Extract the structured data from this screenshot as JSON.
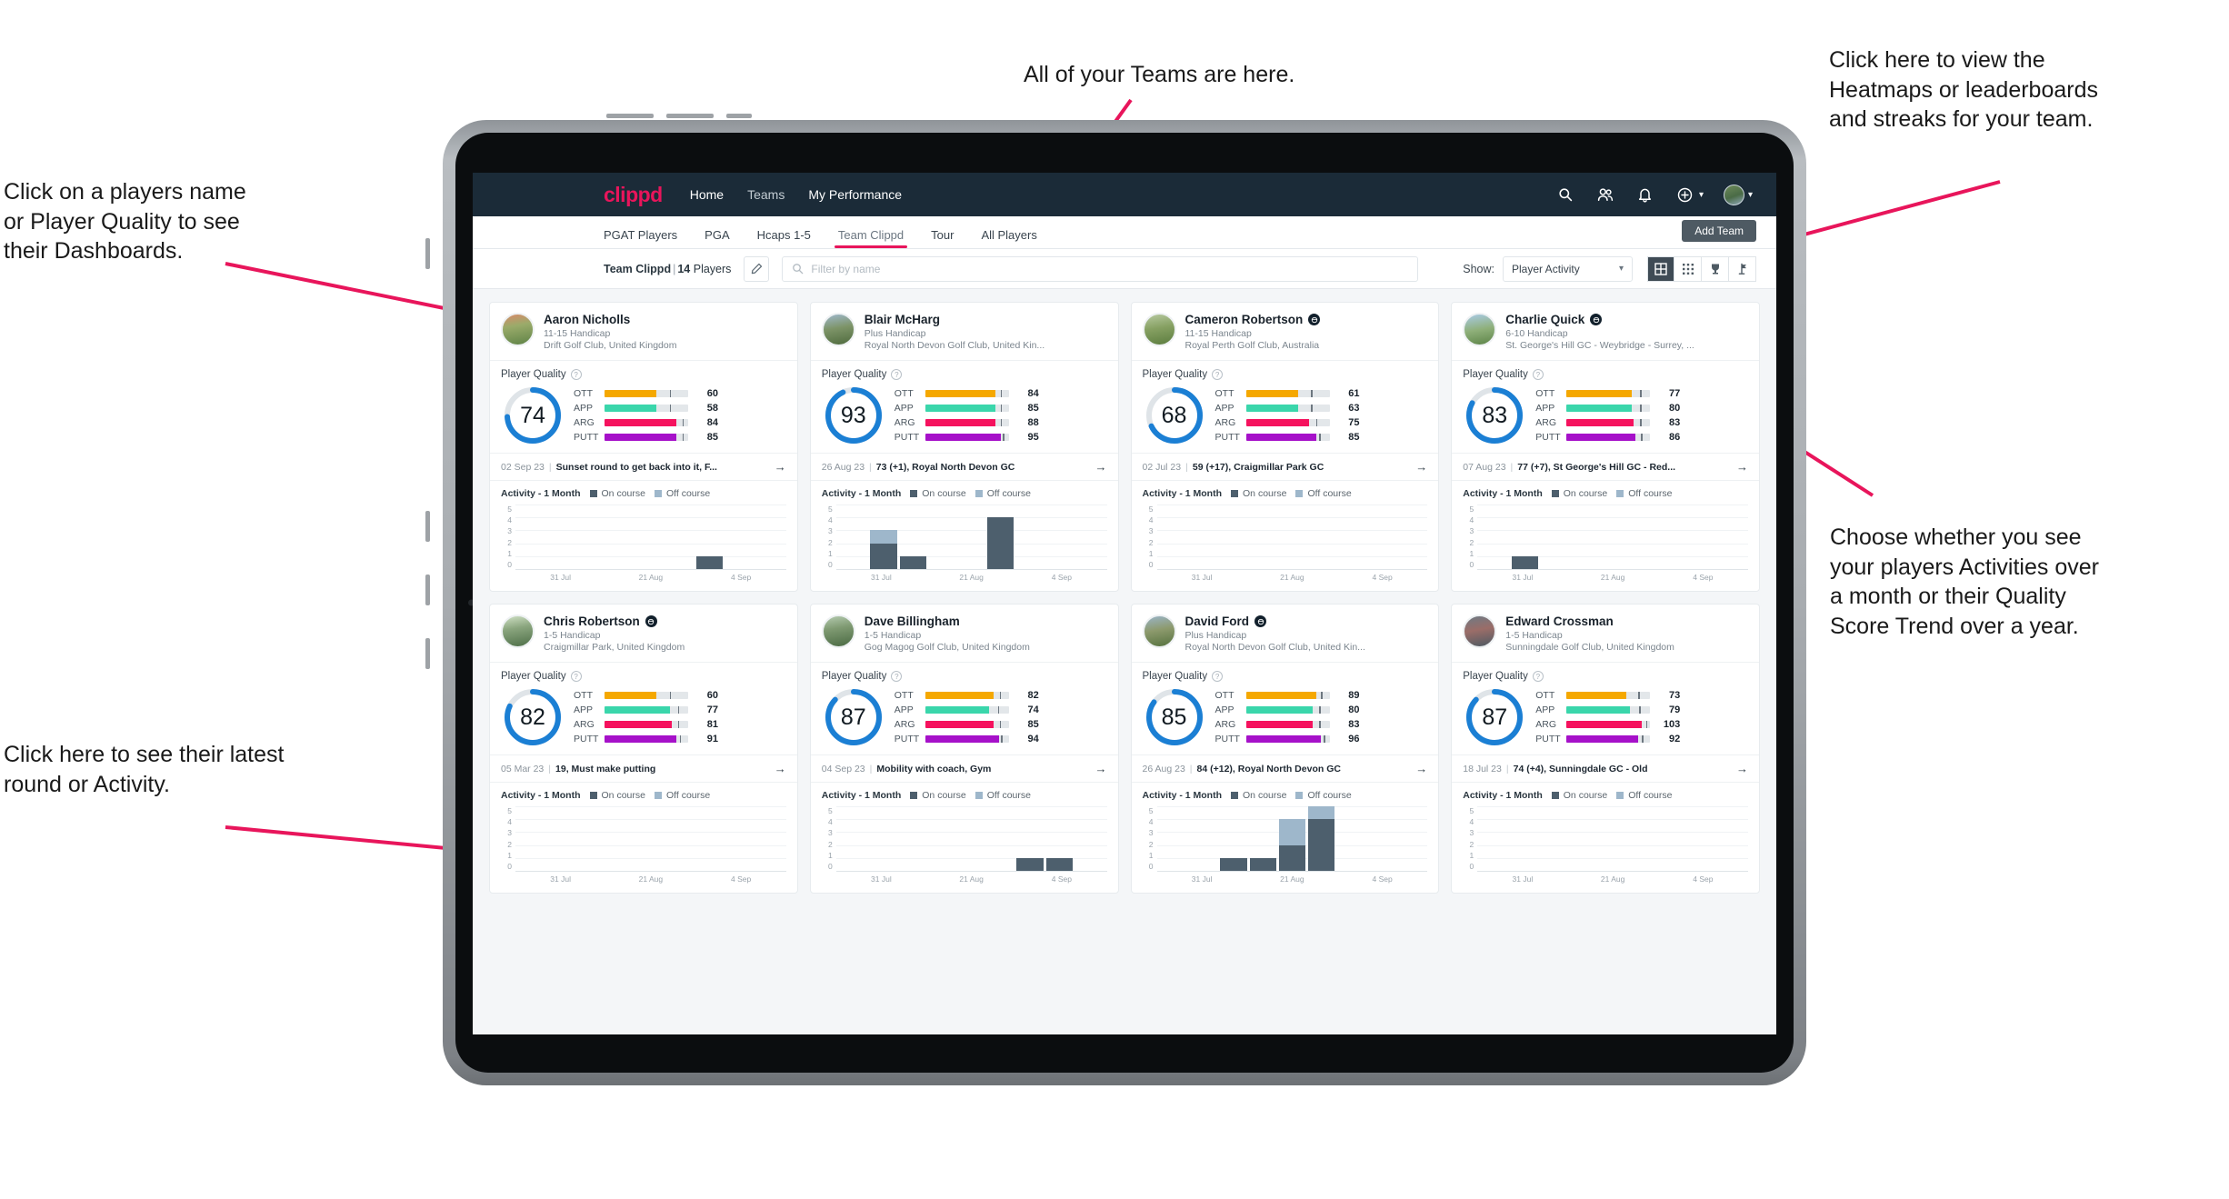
{
  "annotations": [
    {
      "id": "teams",
      "text": "All of your Teams are here."
    },
    {
      "id": "heatmaps",
      "text": "Click here to view the\nHeatmaps or leaderboards\nand streaks for your team."
    },
    {
      "id": "players",
      "text": "Click on a players name\nor Player Quality to see\ntheir Dashboards."
    },
    {
      "id": "activity-choice",
      "text": "Choose whether you see\nyour players Activities over\na month or their Quality\nScore Trend over a year."
    },
    {
      "id": "latest-round",
      "text": "Click here to see their latest\nround or Activity."
    }
  ],
  "app": {
    "logo": "clippd",
    "nav_links": [
      "Home",
      "Teams",
      "My Performance"
    ],
    "nav_icons": [
      "search-icon",
      "people-icon",
      "bell-icon",
      "plus-circle-icon",
      "avatar"
    ],
    "tabs": [
      {
        "label": "PGAT Players",
        "active": false
      },
      {
        "label": "PGA",
        "active": false
      },
      {
        "label": "Hcaps 1-5",
        "active": false
      },
      {
        "label": "Team Clippd",
        "active": true
      },
      {
        "label": "Tour",
        "active": false
      },
      {
        "label": "All Players",
        "active": false
      }
    ],
    "add_team_label": "Add Team",
    "toolbar": {
      "team_name": "Team Clippd",
      "separator": "|",
      "player_count": "14",
      "players_word": "Players",
      "edit_icon": "pencil-icon",
      "search_placeholder": "Filter by name",
      "search_value": "",
      "show_label": "Show:",
      "show_value": "Player Activity",
      "show_options": [
        "Player Activity",
        "Quality Score Trend"
      ],
      "view_buttons": [
        "grid-view-icon",
        "dense-grid-icon",
        "trophy-icon",
        "flag-icon"
      ],
      "active_view": 0
    },
    "card_labels": {
      "player_quality": "Player Quality",
      "activity": "Activity - 1 Month",
      "legend_on": "On course",
      "legend_off": "Off course",
      "help_icon": "question-mark-icon",
      "arrow_icon": "arrow-right-icon"
    }
  },
  "colors": {
    "brand_pink": "#e8155b",
    "nav_bg": "#1b2b38",
    "ott": "#f5a800",
    "app": "#3ad6ab",
    "arg": "#f5125e",
    "putt": "#a611c9",
    "donut": "#1b7fd4",
    "on_course": "#4d5f6d",
    "off_course": "#9eb7cb"
  },
  "chart_axis": {
    "y_ticks": [
      "5",
      "4",
      "3",
      "2",
      "1",
      "0"
    ],
    "y_max": 5,
    "x_ticks": [
      "31 Jul",
      "21 Aug",
      "4 Sep"
    ],
    "slots": 9
  },
  "players": [
    {
      "name": "Aaron Nicholls",
      "badge": false,
      "handicap": "11-15 Handicap",
      "club": "Drift Golf Club, United Kingdom",
      "avatar_grad": "linear-gradient(170deg,#d88b6a 0%,#9aab6a 38%,#5f8347 100%)",
      "quality": 74,
      "metrics": [
        {
          "label": "OTT",
          "value": 60,
          "fill": 62,
          "tick": 78
        },
        {
          "label": "APP",
          "value": 58,
          "fill": 62,
          "tick": 78
        },
        {
          "label": "ARG",
          "value": 84,
          "fill": 86,
          "tick": 93
        },
        {
          "label": "PUTT",
          "value": 85,
          "fill": 86,
          "tick": 93
        }
      ],
      "foot_date": "02 Sep 23",
      "foot_text": "Sunset round to get back into it, F...",
      "chart": {
        "on": [
          0,
          0,
          0,
          0,
          0,
          0,
          1,
          0,
          0
        ],
        "off": [
          0,
          0,
          0,
          0,
          0,
          0,
          0,
          0,
          0
        ]
      }
    },
    {
      "name": "Blair McHarg",
      "badge": false,
      "handicap": "Plus Handicap",
      "club": "Royal North Devon Golf Club, United Kin...",
      "avatar_grad": "linear-gradient(170deg,#9fb8cc 0%,#7d9468 45%,#4f6b3e 100%)",
      "quality": 93,
      "metrics": [
        {
          "label": "OTT",
          "value": 84,
          "fill": 84,
          "tick": 90
        },
        {
          "label": "APP",
          "value": 85,
          "fill": 84,
          "tick": 90
        },
        {
          "label": "ARG",
          "value": 88,
          "fill": 84,
          "tick": 90
        },
        {
          "label": "PUTT",
          "value": 95,
          "fill": 90,
          "tick": 93
        }
      ],
      "foot_date": "26 Aug 23",
      "foot_text": "73 (+1), Royal North Devon GC",
      "chart": {
        "on": [
          0,
          2,
          1,
          0,
          0,
          4,
          0,
          0,
          0
        ],
        "off": [
          0,
          1,
          0,
          0,
          0,
          0,
          0,
          0,
          0
        ]
      }
    },
    {
      "name": "Cameron Robertson",
      "badge": true,
      "handicap": "11-15 Handicap",
      "club": "Royal Perth Golf Club, Australia",
      "avatar_grad": "linear-gradient(170deg,#b7c9a0 0%,#86a062 45%,#5c7d3f 100%)",
      "quality": 68,
      "metrics": [
        {
          "label": "OTT",
          "value": 61,
          "fill": 62,
          "tick": 78
        },
        {
          "label": "APP",
          "value": 63,
          "fill": 62,
          "tick": 78
        },
        {
          "label": "ARG",
          "value": 75,
          "fill": 75,
          "tick": 84
        },
        {
          "label": "PUTT",
          "value": 85,
          "fill": 84,
          "tick": 88
        }
      ],
      "foot_date": "02 Jul 23",
      "foot_text": "59 (+17), Craigmillar Park GC",
      "chart": {
        "on": [
          0,
          0,
          0,
          0,
          0,
          0,
          0,
          0,
          0
        ],
        "off": [
          0,
          0,
          0,
          0,
          0,
          0,
          0,
          0,
          0
        ]
      }
    },
    {
      "name": "Charlie Quick",
      "badge": true,
      "handicap": "6-10 Handicap",
      "club": "St. George's Hill GC - Weybridge - Surrey, ...",
      "avatar_grad": "linear-gradient(170deg,#a9cbe6 0%,#8fb07a 50%,#5d8448 100%)",
      "quality": 83,
      "metrics": [
        {
          "label": "OTT",
          "value": 77,
          "fill": 78,
          "tick": 88
        },
        {
          "label": "APP",
          "value": 80,
          "fill": 78,
          "tick": 88
        },
        {
          "label": "ARG",
          "value": 83,
          "fill": 80,
          "tick": 88
        },
        {
          "label": "PUTT",
          "value": 86,
          "fill": 82,
          "tick": 89
        }
      ],
      "foot_date": "07 Aug 23",
      "foot_text": "77 (+7), St George's Hill GC - Red...",
      "chart": {
        "on": [
          0,
          1,
          0,
          0,
          0,
          0,
          0,
          0,
          0
        ],
        "off": [
          0,
          0,
          0,
          0,
          0,
          0,
          0,
          0,
          0
        ]
      }
    },
    {
      "name": "Chris Robertson",
      "badge": true,
      "handicap": "1-5 Handicap",
      "club": "Craigmillar Park, United Kingdom",
      "avatar_grad": "linear-gradient(170deg,#cfe0c4 0%,#8aa57e 40%,#4e6f48 100%)",
      "quality": 82,
      "metrics": [
        {
          "label": "OTT",
          "value": 60,
          "fill": 62,
          "tick": 78
        },
        {
          "label": "APP",
          "value": 77,
          "fill": 78,
          "tick": 88
        },
        {
          "label": "ARG",
          "value": 81,
          "fill": 80,
          "tick": 88
        },
        {
          "label": "PUTT",
          "value": 91,
          "fill": 86,
          "tick": 90
        }
      ],
      "foot_date": "05 Mar 23",
      "foot_text": "19, Must make putting",
      "chart": {
        "on": [
          0,
          0,
          0,
          0,
          0,
          0,
          0,
          0,
          0
        ],
        "off": [
          0,
          0,
          0,
          0,
          0,
          0,
          0,
          0,
          0
        ]
      }
    },
    {
      "name": "Dave Billingham",
      "badge": false,
      "handicap": "1-5 Handicap",
      "club": "Gog Magog Golf Club, United Kingdom",
      "avatar_grad": "linear-gradient(170deg,#b5cbb0 0%,#7f9a72 40%,#4a6a43 100%)",
      "quality": 87,
      "metrics": [
        {
          "label": "OTT",
          "value": 82,
          "fill": 82,
          "tick": 89
        },
        {
          "label": "APP",
          "value": 74,
          "fill": 76,
          "tick": 87
        },
        {
          "label": "ARG",
          "value": 85,
          "fill": 82,
          "tick": 89
        },
        {
          "label": "PUTT",
          "value": 94,
          "fill": 88,
          "tick": 91
        }
      ],
      "foot_date": "04 Sep 23",
      "foot_text": "Mobility with coach, Gym",
      "chart": {
        "on": [
          0,
          0,
          0,
          0,
          0,
          0,
          1,
          1,
          0
        ],
        "off": [
          0,
          0,
          0,
          0,
          0,
          0,
          0,
          0,
          0
        ]
      }
    },
    {
      "name": "David Ford",
      "badge": true,
      "handicap": "Plus Handicap",
      "club": "Royal North Devon Golf Club, United Kin...",
      "avatar_grad": "linear-gradient(170deg,#9ab4c8 0%,#8d9a6d 45%,#56723f 100%)",
      "quality": 85,
      "metrics": [
        {
          "label": "OTT",
          "value": 89,
          "fill": 84,
          "tick": 90
        },
        {
          "label": "APP",
          "value": 80,
          "fill": 80,
          "tick": 88
        },
        {
          "label": "ARG",
          "value": 83,
          "fill": 80,
          "tick": 88
        },
        {
          "label": "PUTT",
          "value": 96,
          "fill": 90,
          "tick": 93
        }
      ],
      "foot_date": "26 Aug 23",
      "foot_text": "84 (+12), Royal North Devon GC",
      "chart": {
        "on": [
          0,
          0,
          1,
          1,
          2,
          4,
          0,
          0,
          0
        ],
        "off": [
          0,
          0,
          0,
          0,
          2,
          1,
          0,
          0,
          0
        ]
      }
    },
    {
      "name": "Edward Crossman",
      "badge": false,
      "handicap": "1-5 Handicap",
      "club": "Sunningdale Golf Club, United Kingdom",
      "avatar_grad": "linear-gradient(170deg,#6e7a84 0%,#9b6d68 45%,#4d5a63 100%)",
      "quality": 87,
      "metrics": [
        {
          "label": "OTT",
          "value": 73,
          "fill": 72,
          "tick": 86
        },
        {
          "label": "APP",
          "value": 79,
          "fill": 76,
          "tick": 87
        },
        {
          "label": "ARG",
          "value": 103,
          "fill": 90,
          "tick": 95
        },
        {
          "label": "PUTT",
          "value": 92,
          "fill": 86,
          "tick": 90
        }
      ],
      "foot_date": "18 Jul 23",
      "foot_text": "74 (+4), Sunningdale GC - Old",
      "chart": {
        "on": [
          0,
          0,
          0,
          0,
          0,
          0,
          0,
          0,
          0
        ],
        "off": [
          0,
          0,
          0,
          0,
          0,
          0,
          0,
          0,
          0
        ]
      }
    }
  ]
}
